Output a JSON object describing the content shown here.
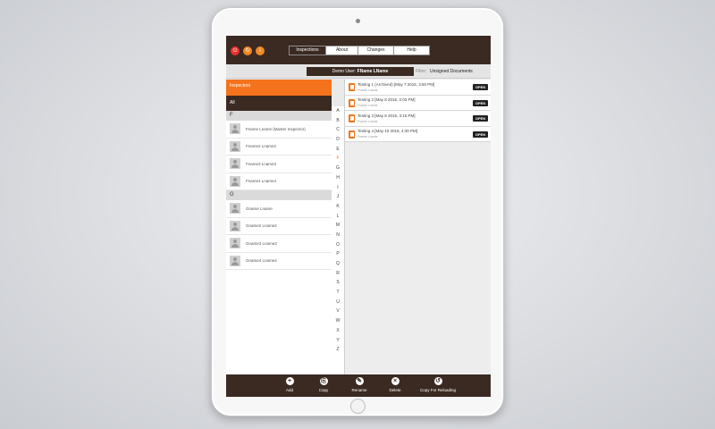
{
  "header": {
    "buttons": [
      {
        "icon": "power-icon",
        "glyph": "⏻"
      },
      {
        "icon": "sync-icon",
        "glyph": "↻"
      },
      {
        "icon": "info-icon",
        "glyph": "i"
      }
    ],
    "tabs": [
      {
        "label": "Inspections",
        "active": true
      },
      {
        "label": "About",
        "active": false
      },
      {
        "label": "Changes",
        "active": false
      },
      {
        "label": "Help",
        "active": false
      }
    ]
  },
  "userbar": {
    "demo_label": "Demo User:",
    "demo_name": "FName LName",
    "filter_label": "Filter:",
    "filter_value": "Unsigned Documents"
  },
  "left": {
    "title": "Inspectors",
    "all_label": "All",
    "sections": [
      {
        "letter": "F",
        "people": [
          "Fname Lname (Master Inspector)",
          "Fname2 Lname2",
          "Fname3 Lname3",
          "Fname4 Lname4"
        ]
      },
      {
        "letter": "G",
        "people": [
          "Gname Lname",
          "Gname2 Lname2",
          "Gname3 Lname3",
          "Gname4 Lname4"
        ]
      }
    ]
  },
  "alphabet": {
    "letters": [
      "A",
      "B",
      "C",
      "D",
      "E",
      "F",
      "G",
      "H",
      "I",
      "J",
      "K",
      "L",
      "M",
      "N",
      "O",
      "P",
      "Q",
      "R",
      "S",
      "T",
      "U",
      "V",
      "W",
      "X",
      "Y",
      "Z"
    ],
    "active": "F"
  },
  "documents": [
    {
      "title": "Testing 1 (Archived) [May 7 2015, 3:50 PM]",
      "sub": "Fname Lname",
      "action": "OPEN"
    },
    {
      "title": "Testing 2 [May 8 2015, 2:03 PM]",
      "sub": "Fname Lname",
      "action": "OPEN"
    },
    {
      "title": "Testing 3 [May 8 2015, 3:15 PM]",
      "sub": "Fname Lname",
      "action": "OPEN"
    },
    {
      "title": "Testing 4 [May 10 2015, 4:30 PM]",
      "sub": "Fname Lname",
      "action": "OPEN"
    }
  ],
  "footer": {
    "buttons": [
      {
        "label": "Add",
        "icon": "add-icon",
        "glyph": "+"
      },
      {
        "label": "Copy",
        "icon": "copy-icon",
        "glyph": "⎘"
      },
      {
        "label": "Rename",
        "icon": "pencil-icon",
        "glyph": "✎"
      },
      {
        "label": "Delete",
        "icon": "trash-icon",
        "glyph": "×"
      },
      {
        "label": "Copy For Reloading",
        "icon": "reload-icon",
        "glyph": "↺"
      }
    ]
  },
  "colors": {
    "header_brown": "#3a2a22",
    "accent_orange": "#f4731c",
    "power_red": "#e8312a"
  }
}
